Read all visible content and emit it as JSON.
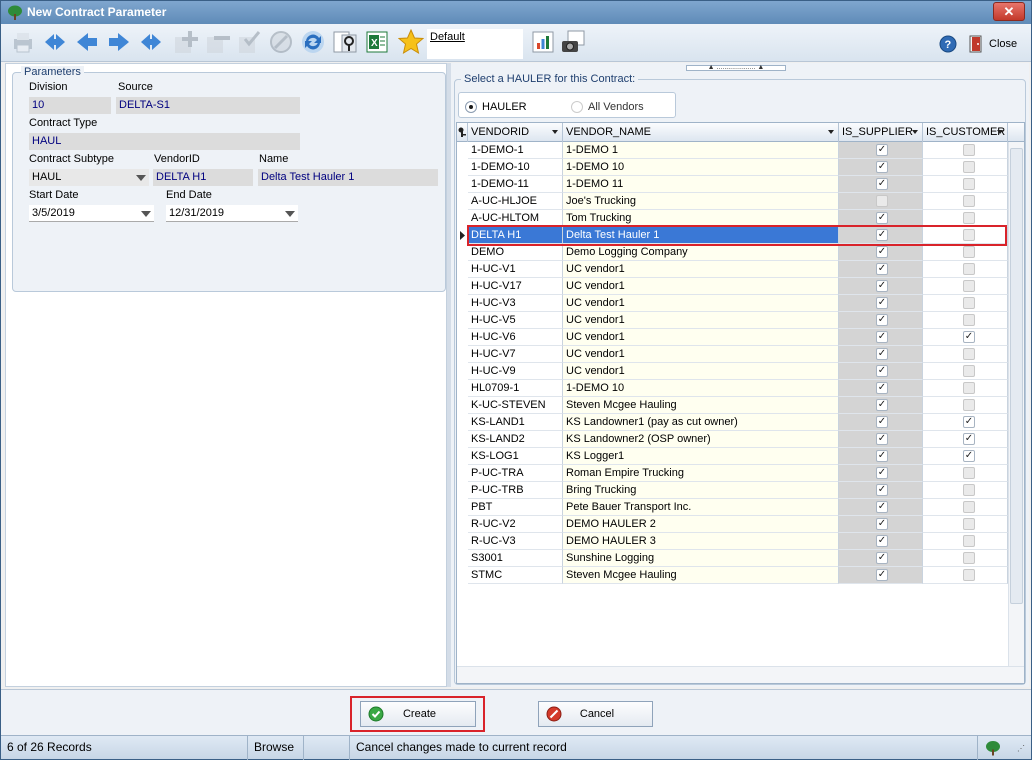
{
  "window": {
    "title": "New Contract Parameter",
    "close_glyph": "✕"
  },
  "toolbar": {
    "buttons": [
      {
        "name": "print-icon",
        "enabled": false
      },
      {
        "name": "first-record-icon",
        "enabled": true
      },
      {
        "name": "prior-record-icon",
        "enabled": true
      },
      {
        "name": "next-record-icon",
        "enabled": true
      },
      {
        "name": "last-record-icon",
        "enabled": true
      },
      {
        "name": "add-record-icon",
        "enabled": false
      },
      {
        "name": "delete-record-icon",
        "enabled": false
      },
      {
        "name": "post-edit-icon",
        "enabled": false
      },
      {
        "name": "cancel-edit-icon",
        "enabled": false
      },
      {
        "name": "refresh-icon",
        "enabled": true
      },
      {
        "name": "find-icon",
        "enabled": true
      },
      {
        "name": "excel-export-icon",
        "enabled": true
      },
      {
        "name": "favorite-star-icon",
        "enabled": true
      }
    ],
    "layout_link": "Default",
    "close_label": "Close"
  },
  "parameters": {
    "group_label": "Parameters",
    "division_label": "Division",
    "division_value": "10",
    "source_label": "Source",
    "source_value": "DELTA-S1",
    "contract_type_label": "Contract Type",
    "contract_type_value": "HAUL",
    "contract_subtype_label": "Contract Subtype",
    "contract_subtype_value": "HAUL",
    "vendor_id_label": "VendorID",
    "vendor_id_value": "DELTA H1",
    "name_label": "Name",
    "name_value": "Delta Test Hauler 1",
    "start_date_label": "Start Date",
    "start_date_value": "3/5/2019",
    "end_date_label": "End Date",
    "end_date_value": "12/31/2019"
  },
  "hauler": {
    "group_label": "Select a HAULER for this Contract:",
    "radio_hauler": "HAULER",
    "radio_all": "All Vendors",
    "selected_radio": "HAULER"
  },
  "grid": {
    "columns": [
      "VENDORID",
      "VENDOR_NAME",
      "IS_SUPPLIER",
      "IS_CUSTOMER"
    ],
    "current_row": 5,
    "rows": [
      {
        "id": "1-DEMO-1",
        "name": "1-DEMO 1",
        "supplier": true,
        "customer": false
      },
      {
        "id": "1-DEMO-10",
        "name": "1-DEMO 10",
        "supplier": true,
        "customer": false
      },
      {
        "id": "1-DEMO-11",
        "name": "1-DEMO 11",
        "supplier": true,
        "customer": false
      },
      {
        "id": "A-UC-HLJOE",
        "name": "Joe's Trucking",
        "supplier": false,
        "customer": false
      },
      {
        "id": "A-UC-HLTOM",
        "name": "Tom Trucking",
        "supplier": true,
        "customer": false
      },
      {
        "id": "DELTA H1",
        "name": "Delta Test Hauler 1",
        "supplier": true,
        "customer": false
      },
      {
        "id": "DEMO",
        "name": "Demo Logging Company",
        "supplier": true,
        "customer": false
      },
      {
        "id": "H-UC-V1",
        "name": "UC vendor1",
        "supplier": true,
        "customer": false
      },
      {
        "id": "H-UC-V17",
        "name": "UC vendor1",
        "supplier": true,
        "customer": false
      },
      {
        "id": "H-UC-V3",
        "name": "UC vendor1",
        "supplier": true,
        "customer": false
      },
      {
        "id": "H-UC-V5",
        "name": "UC vendor1",
        "supplier": true,
        "customer": false
      },
      {
        "id": "H-UC-V6",
        "name": "UC vendor1",
        "supplier": true,
        "customer": true
      },
      {
        "id": "H-UC-V7",
        "name": "UC vendor1",
        "supplier": true,
        "customer": false
      },
      {
        "id": "H-UC-V9",
        "name": "UC vendor1",
        "supplier": true,
        "customer": false
      },
      {
        "id": "HL0709-1",
        "name": "1-DEMO 10",
        "supplier": true,
        "customer": false
      },
      {
        "id": "K-UC-STEVEN",
        "name": "Steven Mcgee Hauling",
        "supplier": true,
        "customer": false
      },
      {
        "id": "KS-LAND1",
        "name": "KS Landowner1 (pay as cut owner)",
        "supplier": true,
        "customer": true
      },
      {
        "id": "KS-LAND2",
        "name": "KS Landowner2 (OSP owner)",
        "supplier": true,
        "customer": true
      },
      {
        "id": "KS-LOG1",
        "name": "KS Logger1",
        "supplier": true,
        "customer": true
      },
      {
        "id": "P-UC-TRA",
        "name": "Roman Empire Trucking",
        "supplier": true,
        "customer": false
      },
      {
        "id": "P-UC-TRB",
        "name": "Bring Trucking",
        "supplier": true,
        "customer": false
      },
      {
        "id": "PBT",
        "name": "Pete Bauer Transport Inc.",
        "supplier": true,
        "customer": false
      },
      {
        "id": "R-UC-V2",
        "name": "DEMO HAULER 2",
        "supplier": true,
        "customer": false
      },
      {
        "id": "R-UC-V3",
        "name": "DEMO HAULER 3",
        "supplier": true,
        "customer": false
      },
      {
        "id": "S3001",
        "name": "Sunshine Logging",
        "supplier": true,
        "customer": false
      },
      {
        "id": "STMC",
        "name": "Steven Mcgee Hauling",
        "supplier": true,
        "customer": false
      }
    ]
  },
  "buttons": {
    "create_label": "Create",
    "cancel_label": "Cancel"
  },
  "status": {
    "records": "6 of 26 Records",
    "mode": "Browse",
    "hint": "Cancel changes made to current record"
  },
  "colors": {
    "accent": "#3a78d6",
    "highlight_red": "#d9232a",
    "alt_row": "#fffff0"
  }
}
